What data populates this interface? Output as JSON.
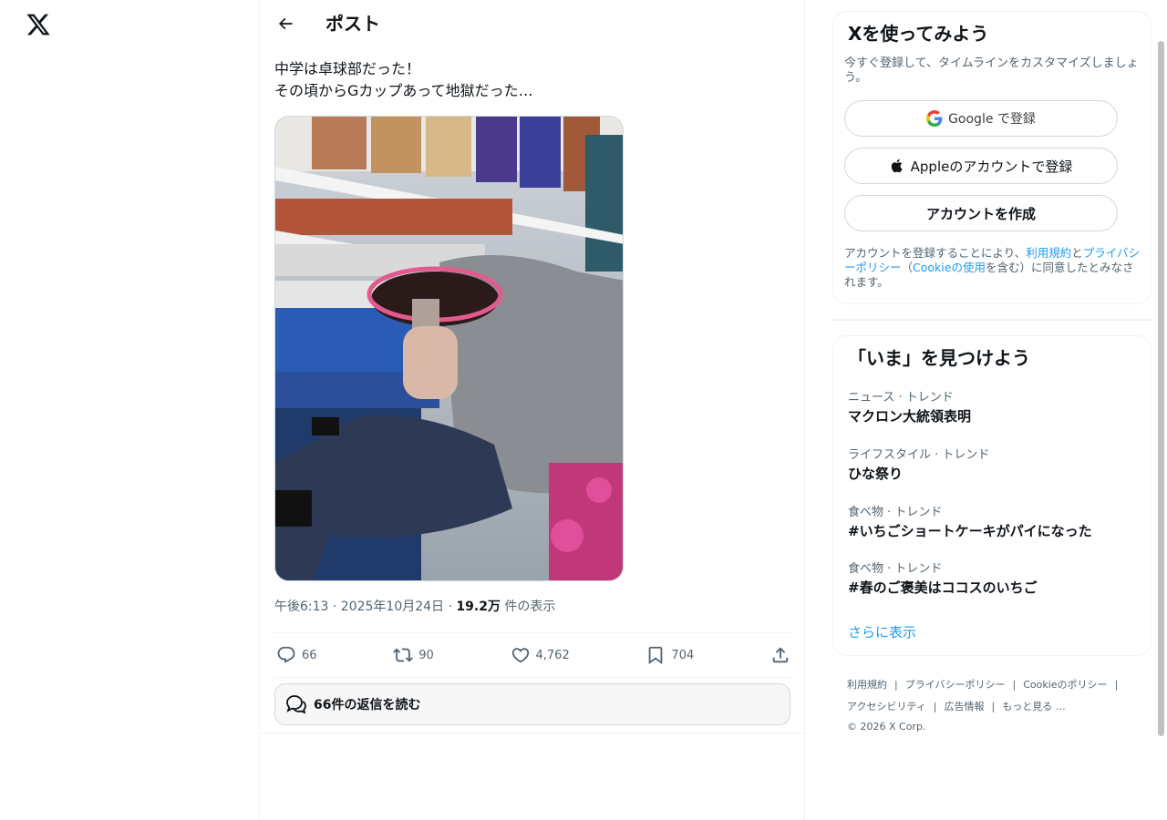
{
  "header": {
    "title": "ポスト"
  },
  "post": {
    "text": "中学は卓球部だった！\nその頃からGカップあって地獄だった…",
    "time": "午後6:13 · 2025年10月24日 · ",
    "views_count": "19.2万",
    "views_label": " 件の表示",
    "actions": {
      "replies": "66",
      "reposts": "90",
      "likes": "4,762",
      "bookmarks": "704"
    },
    "read_replies": "66件の返信を読む"
  },
  "signup": {
    "title": "Xを使ってみよう",
    "subtitle": "今すぐ登録して、タイムラインをカスタマイズしましょう。",
    "google_btn": "Google で登録",
    "apple_btn": "Appleのアカウントで登録",
    "create_btn": "アカウントを作成",
    "legal_pre": "アカウントを登録することにより、",
    "terms": "利用規約",
    "and": "と",
    "privacy": "プライバシーポリシー",
    "paren_open": "（",
    "cookie": "Cookieの使用",
    "legal_post": "を含む）に同意したとみなされます。"
  },
  "trends": {
    "title": "「いま」を見つけよう",
    "items": [
      {
        "category": "ニュース · トレンド",
        "name": "マクロン大統領表明"
      },
      {
        "category": "ライフスタイル · トレンド",
        "name": "ひな祭り"
      },
      {
        "category": "食べ物 · トレンド",
        "name": "#いちごショートケーキがパイになった"
      },
      {
        "category": "食べ物 · トレンド",
        "name": "#春のご褒美はココスのいちご"
      }
    ],
    "show_more": "さらに表示"
  },
  "footer": {
    "links": [
      "利用規約",
      "プライバシーポリシー",
      "Cookieのポリシー",
      "アクセシビリティ",
      "広告情報",
      "もっと見る …"
    ],
    "copyright": "© 2026 X Corp."
  },
  "colors": {
    "accent": "#1d9bf0",
    "text": "#0f1419",
    "secondary": "#536471",
    "border": "#eff3f4"
  }
}
